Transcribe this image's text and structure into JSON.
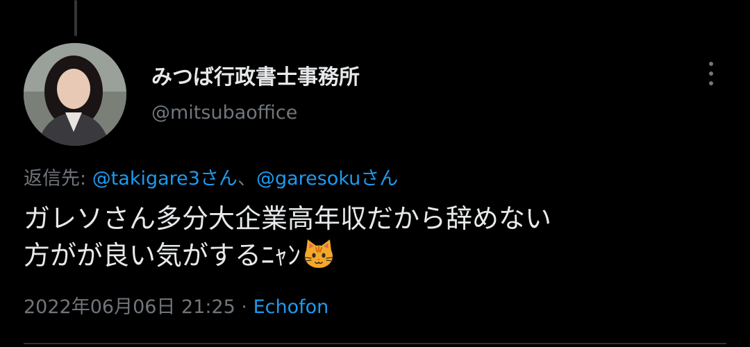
{
  "tweet": {
    "author": {
      "display_name": "みつば行政書士事務所",
      "handle": "@mitsubaoffice"
    },
    "reply_to": {
      "prefix": "返信先: ",
      "mention_1": "@takigare3さん",
      "separator": "、",
      "mention_2": "@garesokuさん"
    },
    "text": "ガレソさん多分大企業高年収だから辞めない\n方がが良い気がするﾆｬﾝ",
    "emoji": "cat-face-emoji",
    "timestamp": "2022年06月06日 21:25",
    "meta_separator": " · ",
    "source": "Echofon"
  },
  "icons": {
    "more": "more-vertical-icon"
  },
  "colors": {
    "background": "#000000",
    "primary_text": "#e7e9ea",
    "secondary_text": "#71767b",
    "link": "#1d9bf0",
    "divider": "#2f3336"
  }
}
